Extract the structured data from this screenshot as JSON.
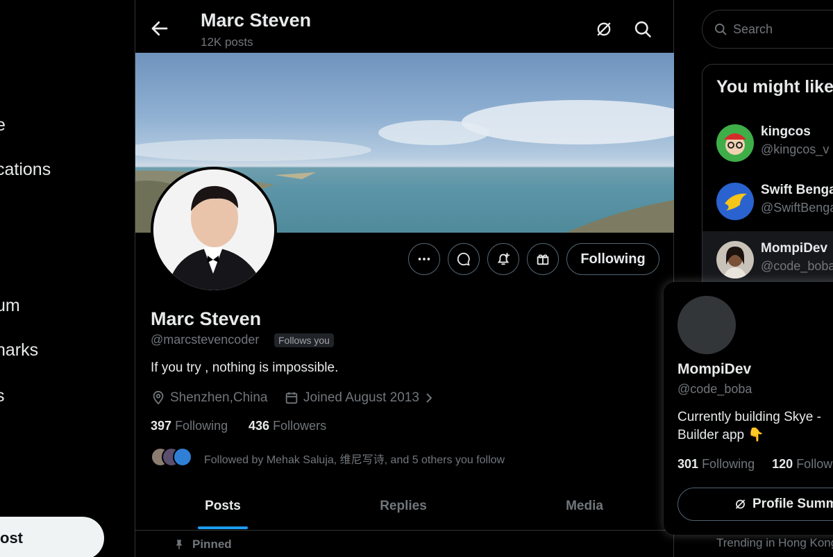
{
  "nav": {
    "items": [
      {
        "label": "e"
      },
      {
        "label": "cations"
      },
      {
        "label": "um"
      },
      {
        "label": "narks"
      },
      {
        "label": "s"
      }
    ],
    "post_label": "ost"
  },
  "header": {
    "title": "Marc Steven",
    "subtitle": "12K posts"
  },
  "profile": {
    "name": "Marc Steven",
    "handle": "@marcstevencoder",
    "follows_badge": "Follows you",
    "bio": "If you try , nothing is impossible.",
    "location": "Shenzhen,China",
    "joined": "Joined August 2013",
    "following_count": "397",
    "following_label": "Following",
    "followers_count": "436",
    "followers_label": "Followers",
    "followed_by": "Followed by Mehak Saluja, 维尼写诗, and 5 others you follow",
    "following_button": "Following"
  },
  "tabs": [
    {
      "label": "Posts",
      "active": true
    },
    {
      "label": "Replies",
      "active": false
    },
    {
      "label": "Media",
      "active": false
    }
  ],
  "pinned_label": "Pinned",
  "search": {
    "placeholder": "Search"
  },
  "recommendations": {
    "title": "You might like",
    "items": [
      {
        "name": "kingcos",
        "handle": "@kingcos_v"
      },
      {
        "name": "Swift Bengal",
        "handle": "@SwiftBengal"
      },
      {
        "name": "MompiDev",
        "handle": "@code_boba"
      }
    ]
  },
  "trending": "Trending in Hong Kong",
  "hovercard": {
    "name": "MompiDev",
    "handle": "@code_boba",
    "bio": "Currently building Skye - Builder app 👇",
    "following_count": "301",
    "following_label": "Following",
    "followers_count": "120",
    "followers_label": "Followers",
    "button_label": "Profile Summary"
  },
  "colors": {
    "accent": "#1d9bf0",
    "background": "#000000",
    "muted_text": "#71767b",
    "border": "#2f3336"
  }
}
